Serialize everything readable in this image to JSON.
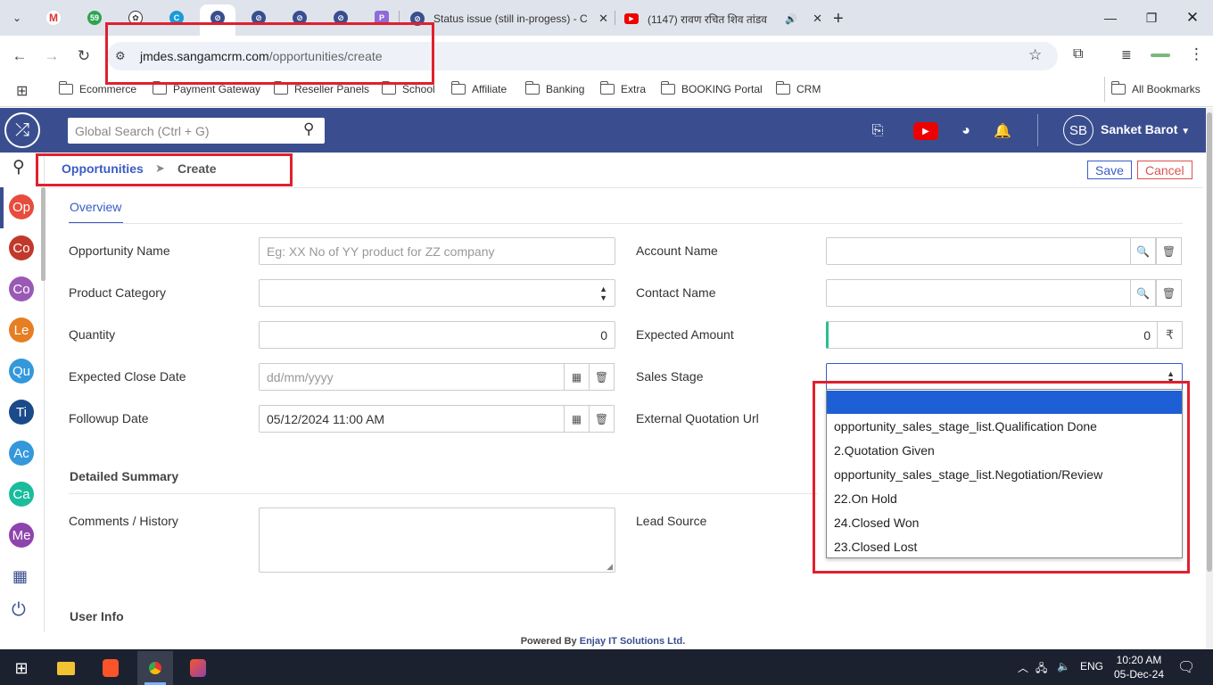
{
  "browser": {
    "tabs": [
      {
        "title": "Status issue (still in-progess) - C",
        "icon": "chatgpt-like-icon"
      },
      {
        "title": "(1147) रावण रचित शिव तांडव",
        "icon": "youtube-icon"
      }
    ],
    "pinned_badge": "59",
    "url_host": "jmdes.sangamcrm.com",
    "url_path": "/opportunities/create",
    "bookmarks": [
      "Ecommerce",
      "Payment Gateway",
      "Reseller Panels",
      "School",
      "Affiliate",
      "Banking",
      "Extra",
      "BOOKING Portal",
      "CRM"
    ],
    "all_bookmarks": "All Bookmarks"
  },
  "app": {
    "search_placeholder": "Global Search (Ctrl + G)",
    "user_initials": "SB",
    "user_name": "Sanket Barot",
    "sidebar": [
      "Op",
      "Co",
      "Co",
      "Le",
      "Qu",
      "Ti",
      "Ac",
      "Ca",
      "Me"
    ],
    "sidebar_colors": [
      "#e74c3c",
      "#c0392b",
      "#9b59b6",
      "#e67e22",
      "#3498db",
      "#1a4a8a",
      "#3498db",
      "#1abc9c",
      "#8e44ad"
    ],
    "breadcrumb_module": "Opportunities",
    "breadcrumb_sep": "➤",
    "breadcrumb_page": "Create",
    "save_label": "Save",
    "cancel_label": "Cancel",
    "tab_overview": "Overview"
  },
  "form": {
    "opportunity_name": {
      "label": "Opportunity Name",
      "placeholder": "Eg: XX No of YY product for ZZ company",
      "value": ""
    },
    "product_category": {
      "label": "Product Category",
      "value": ""
    },
    "quantity": {
      "label": "Quantity",
      "value": "0"
    },
    "expected_close_date": {
      "label": "Expected Close Date",
      "placeholder": "dd/mm/yyyy"
    },
    "followup_date": {
      "label": "Followup Date",
      "value": "05/12/2024 11:00 AM"
    },
    "account_name": {
      "label": "Account Name",
      "value": ""
    },
    "contact_name": {
      "label": "Contact Name",
      "value": ""
    },
    "expected_amount": {
      "label": "Expected Amount",
      "value": "0",
      "currency": "₹"
    },
    "sales_stage": {
      "label": "Sales Stage",
      "value": "",
      "options": [
        "",
        "opportunity_sales_stage_list.Qualification Done",
        "2.Quotation Given",
        "opportunity_sales_stage_list.Negotiation/Review",
        "22.On Hold",
        "24.Closed Won",
        "23.Closed Lost"
      ],
      "highlighted_index": 0
    },
    "external_quotation_url": {
      "label": "External Quotation Url"
    },
    "detailed_summary_title": "Detailed Summary",
    "comments": {
      "label": "Comments / History",
      "value": ""
    },
    "lead_source": {
      "label": "Lead Source"
    },
    "user_info_title": "User Info"
  },
  "footer": {
    "powered_by": "Powered By",
    "company": "Enjay IT Solutions Ltd."
  },
  "taskbar": {
    "lang": "ENG",
    "time": "10:20 AM",
    "date": "05-Dec-24"
  },
  "colors": {
    "header": "#3a4e8f",
    "link": "#3a5cc6",
    "highlight": "#1e5fd6",
    "annotation": "#e0202e"
  }
}
